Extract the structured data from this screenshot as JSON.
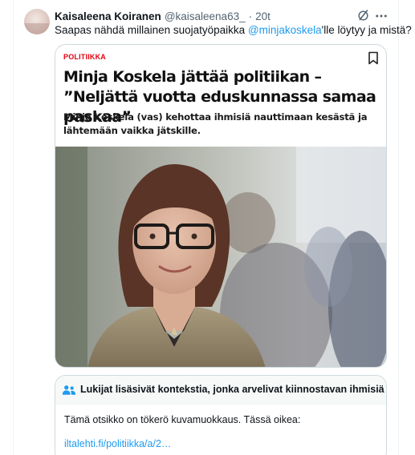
{
  "tweet": {
    "author_name": "Kaisaleena Koiranen",
    "author_handle": "@kaisaleena63_",
    "separator": "·",
    "timestamp": "20t",
    "text_before": "Saapas nähdä millainen suojatyöpaikka ",
    "mention": "@minjakoskela",
    "text_after": "'lle löytyy ja mistä?"
  },
  "article": {
    "category": "POLITIIKKA",
    "title": "Minja Koskela jättää politiikan – ”Neljättä vuotta eduskunnassa samaa paskaa”",
    "lead": "Minja Koskela (vas) kehottaa ihmisiä nauttimaan kesästä ja lähtemään vaikka jätskille."
  },
  "community_note": {
    "title": "Lukijat lisäsivät kontekstia, jonka arvelivat kiinnostavan ihmisiä",
    "body": "Tämä otsikko on tökerö kuvamuokkaus. Tässä oikea:",
    "link": "iltalehti.fi/politiikka/a/2…"
  },
  "icons": {
    "grok": "grok-icon",
    "more": "more-icon",
    "bookmark": "bookmark-icon",
    "people": "people-icon"
  },
  "colors": {
    "link": "#1d9bf0",
    "category": "#e3000f",
    "text": "#0f1419",
    "secondary": "#536471"
  }
}
